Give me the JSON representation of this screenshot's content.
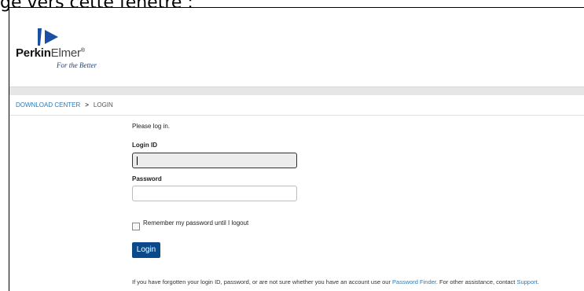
{
  "caption": "ge vers cette fenêtre :",
  "brand": {
    "name_bold": "Perkin",
    "name_light": "Elmer",
    "trademark": "®",
    "tagline": "For the Better",
    "accent_color": "#1a4fa3"
  },
  "breadcrumb": {
    "root": "DOWNLOAD CENTER",
    "separator": ">",
    "current": "LOGIN"
  },
  "form": {
    "intro": "Please log in.",
    "login_id_label": "Login ID",
    "login_id_value": "",
    "password_label": "Password",
    "password_value": "",
    "remember_label": "Remember my password until I logout",
    "remember_checked": false,
    "login_button": "Login",
    "button_color": "#0a4a8a"
  },
  "help": {
    "text_before": "If you have forgotten your login ID, password, or are not sure whether you have an account use our ",
    "finder_link": "Password Finder",
    "text_middle": ". For other assistance, contact ",
    "support_link": "Support",
    "text_end": "."
  }
}
